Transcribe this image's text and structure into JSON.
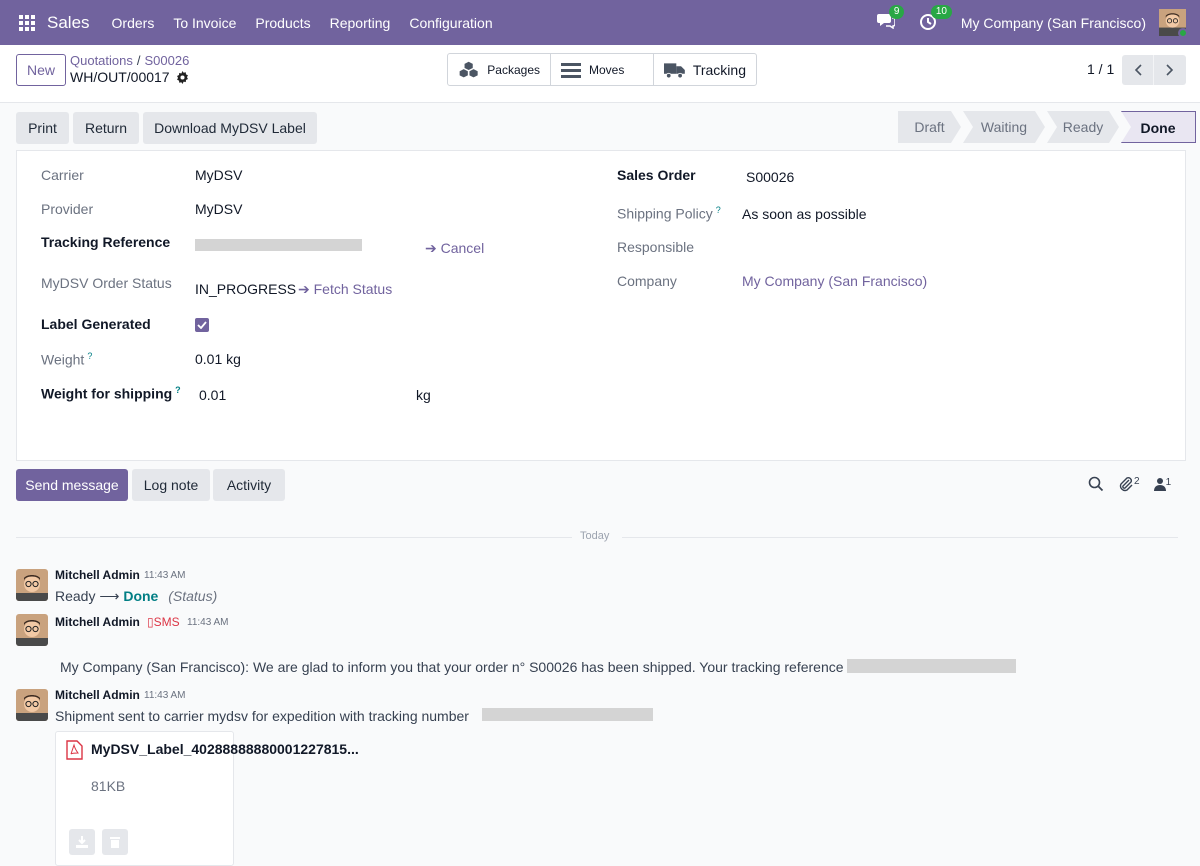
{
  "navbar": {
    "app_name": "Sales",
    "menu": [
      "Orders",
      "To Invoice",
      "Products",
      "Reporting",
      "Configuration"
    ],
    "messages_count": "9",
    "activities_count": "10",
    "company": "My Company (San Francisco)"
  },
  "control": {
    "new_label": "New",
    "breadcrumb": [
      "Quotations",
      "S00026"
    ],
    "record": "WH/OUT/00017",
    "smart_buttons": [
      "Packages",
      "Moves",
      "Tracking"
    ],
    "pager": "1 / 1"
  },
  "actions": {
    "print": "Print",
    "return": "Return",
    "download_label": "Download MyDSV Label"
  },
  "statusbar": [
    "Draft",
    "Waiting",
    "Ready",
    "Done"
  ],
  "form": {
    "carrier_label": "Carrier",
    "carrier": "MyDSV",
    "provider_label": "Provider",
    "provider": "MyDSV",
    "tracking_ref_label": "Tracking Reference",
    "cancel_label": "Cancel",
    "order_status_label": "MyDSV Order Status",
    "order_status": "IN_PROGRESS",
    "fetch_status_label": "Fetch Status",
    "label_generated_label": "Label Generated",
    "label_generated": true,
    "weight_label": "Weight",
    "weight": "0.01",
    "weight_unit": "kg",
    "weight_shipping_label": "Weight for shipping",
    "weight_shipping": "0.01",
    "weight_shipping_unit": "kg",
    "help_mark": "?",
    "sales_order_label": "Sales Order",
    "sales_order": "S00026",
    "shipping_policy_label": "Shipping Policy",
    "shipping_policy": "As soon as possible",
    "responsible_label": "Responsible",
    "company_label": "Company",
    "company": "My Company (San Francisco)"
  },
  "chatter": {
    "send_message": "Send message",
    "log_note": "Log note",
    "activity": "Activity",
    "attachments_count": "2",
    "followers_count": "1",
    "date_separator": "Today",
    "messages": [
      {
        "author": "Mitchell Admin",
        "time": "11:43 AM",
        "from": "Ready",
        "to": "Done",
        "field": "(Status)"
      },
      {
        "author": "Mitchell Admin",
        "sms": "SMS",
        "time": "11:43 AM",
        "body": "My Company (San Francisco): We are glad to inform you that your order n° S00026 has been shipped. Your tracking reference is"
      },
      {
        "author": "Mitchell Admin",
        "time": "11:43 AM",
        "body": "Shipment sent to carrier mydsv for expedition with tracking number"
      }
    ],
    "attachment": {
      "name": "MyDSV_Label_40288888880001227815...",
      "size": "81KB"
    }
  },
  "colors": {
    "brand": "#71639e",
    "success": "#28a745",
    "danger": "#dc3545"
  }
}
